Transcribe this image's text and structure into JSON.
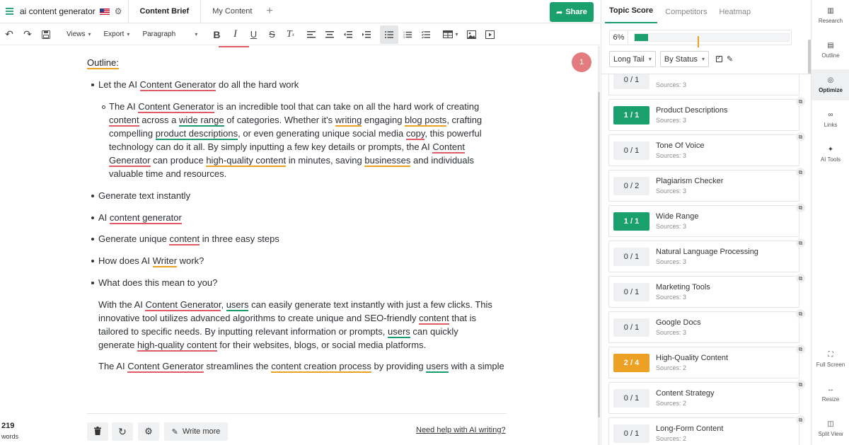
{
  "topbar": {
    "doc_title": "ai content generator",
    "tabs": [
      "Content Brief",
      "My Content"
    ],
    "share_label": "Share"
  },
  "toolbar": {
    "views_label": "Views",
    "export_label": "Export",
    "paragraph_label": "Paragraph"
  },
  "editor": {
    "outline_label": "Outline:",
    "comment_count": "1",
    "bullets": [
      "Let the AI Content Generator do all the hard work",
      "Generate text instantly",
      "AI content generator",
      "Generate unique content in three easy steps",
      "How does AI Writer work?",
      "What does this mean to you?"
    ],
    "sub_paragraph": "The AI Content Generator is an incredible tool that can take on all the hard work of creating content across a wide range of categories. Whether it's writing engaging blog posts, crafting compelling product descriptions, or even generating unique social media copy, this powerful technology can do it all. By simply inputting a few key details or prompts, the AI Content Generator can produce high-quality content in minutes, saving businesses and individuals valuable time and resources.",
    "paragraph_1": "With the AI Content Generator, users can easily generate text instantly with just a few clicks. This innovative tool utilizes advanced algorithms to create unique and SEO-friendly content that is tailored to specific needs. By inputting relevant information or prompts, users can quickly generate high-quality content for their websites, blogs, or social media platforms.",
    "paragraph_2": "The AI Content Generator streamlines the content creation process by providing users with a simple",
    "write_more_label": "Write more",
    "help_link": "Need help with AI writing?",
    "word_count": "219",
    "word_label": "words"
  },
  "panel": {
    "tabs": [
      "Topic Score",
      "Competitors",
      "Heatmap"
    ],
    "score_text": "6%",
    "score_value": 0.06,
    "score_target": 0.41,
    "filter_1": "Long Tail",
    "filter_2": "By Status",
    "keywords": [
      {
        "count": "0 / 1",
        "name": "",
        "sources": "Sources: 3",
        "status": "none"
      },
      {
        "count": "1 / 1",
        "name": "Product Descriptions",
        "sources": "Sources: 3",
        "status": "full"
      },
      {
        "count": "0 / 1",
        "name": "Tone Of Voice",
        "sources": "Sources: 3",
        "status": "none"
      },
      {
        "count": "0 / 2",
        "name": "Plagiarism Checker",
        "sources": "Sources: 3",
        "status": "none"
      },
      {
        "count": "1 / 1",
        "name": "Wide Range",
        "sources": "Sources: 3",
        "status": "full"
      },
      {
        "count": "0 / 1",
        "name": "Natural Language Processing",
        "sources": "Sources: 3",
        "status": "none"
      },
      {
        "count": "0 / 1",
        "name": "Marketing Tools",
        "sources": "Sources: 3",
        "status": "none"
      },
      {
        "count": "0 / 1",
        "name": "Google Docs",
        "sources": "Sources: 3",
        "status": "none"
      },
      {
        "count": "2 / 4",
        "name": "High-Quality Content",
        "sources": "Sources: 2",
        "status": "partial"
      },
      {
        "count": "0 / 1",
        "name": "Content Strategy",
        "sources": "Sources: 2",
        "status": "none"
      },
      {
        "count": "0 / 1",
        "name": "Long-Form Content",
        "sources": "Sources: 2",
        "status": "none"
      }
    ]
  },
  "sidenav": {
    "items": [
      "Research",
      "Outline",
      "Optimize",
      "Links",
      "AI Tools",
      "Full Screen",
      "Resize",
      "Split View"
    ]
  },
  "colors": {
    "brand_green": "#1aa06d",
    "warn_orange": "#eda124",
    "error_red": "#e05b66",
    "comment_red": "#e47b7e"
  }
}
